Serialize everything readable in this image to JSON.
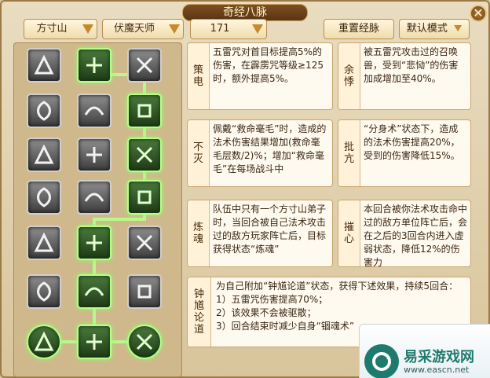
{
  "window": {
    "title": "奇经八脉",
    "close_label": "✕"
  },
  "toolbar": {
    "school": "方寸山",
    "faction": "伏魔天师",
    "level": "171",
    "reset_label": "重置经脉",
    "mode_label": "默认模式"
  },
  "grid": {
    "rows": 7,
    "cols": 3,
    "active": [
      [
        0,
        1
      ],
      [
        1,
        2
      ],
      [
        2,
        2
      ],
      [
        3,
        2
      ],
      [
        4,
        1
      ],
      [
        5,
        1
      ],
      [
        6,
        0
      ],
      [
        6,
        1
      ],
      [
        6,
        2
      ]
    ],
    "glow_color": "#b7ff8a"
  },
  "cards": [
    {
      "title": "策电",
      "desc": "五雷咒对首目标提高5%的伤害，在霹雳咒等级≥125时，额外提高5%。"
    },
    {
      "title": "余悸",
      "desc": "被五雷咒攻击过的召唤兽，受到“悲恸”的伤害加成增加至40%。"
    },
    {
      "title": "不灭",
      "desc": "佩戴“救命毫毛”时，造成的法术伤害结果增加(救命毫毛层数/2)%；增加“救命毫毛”在每场战斗中"
    },
    {
      "title": "批亢",
      "desc": "“分身术”状态下，造成的法术伤害提高20%，受到的伤害降低15%。"
    },
    {
      "title": "炼魂",
      "desc": "队伍中只有一个方寸山弟子时，当回合被自己法术攻击过的敌方玩家阵亡后，目标获得状态“炼魂”"
    },
    {
      "title": "摧心",
      "desc": "本回合被你法术攻击命中过的敌方单位阵亡后，会在之后的3回合内进入虚弱状态，降低12%的伤害力"
    },
    {
      "title": "钟馗论道",
      "desc_lines": [
        "为自己附加“钟馗论道”状态，获得下述效果，持续5回合：",
        "1）五雷咒伤害提高70%；",
        "2）该效果不会被驱散；",
        "3）回合结束时减少自身“锢魂术”"
      ]
    }
  ],
  "watermark": {
    "title": "易采游戏网",
    "url": "www.eascn.net"
  }
}
